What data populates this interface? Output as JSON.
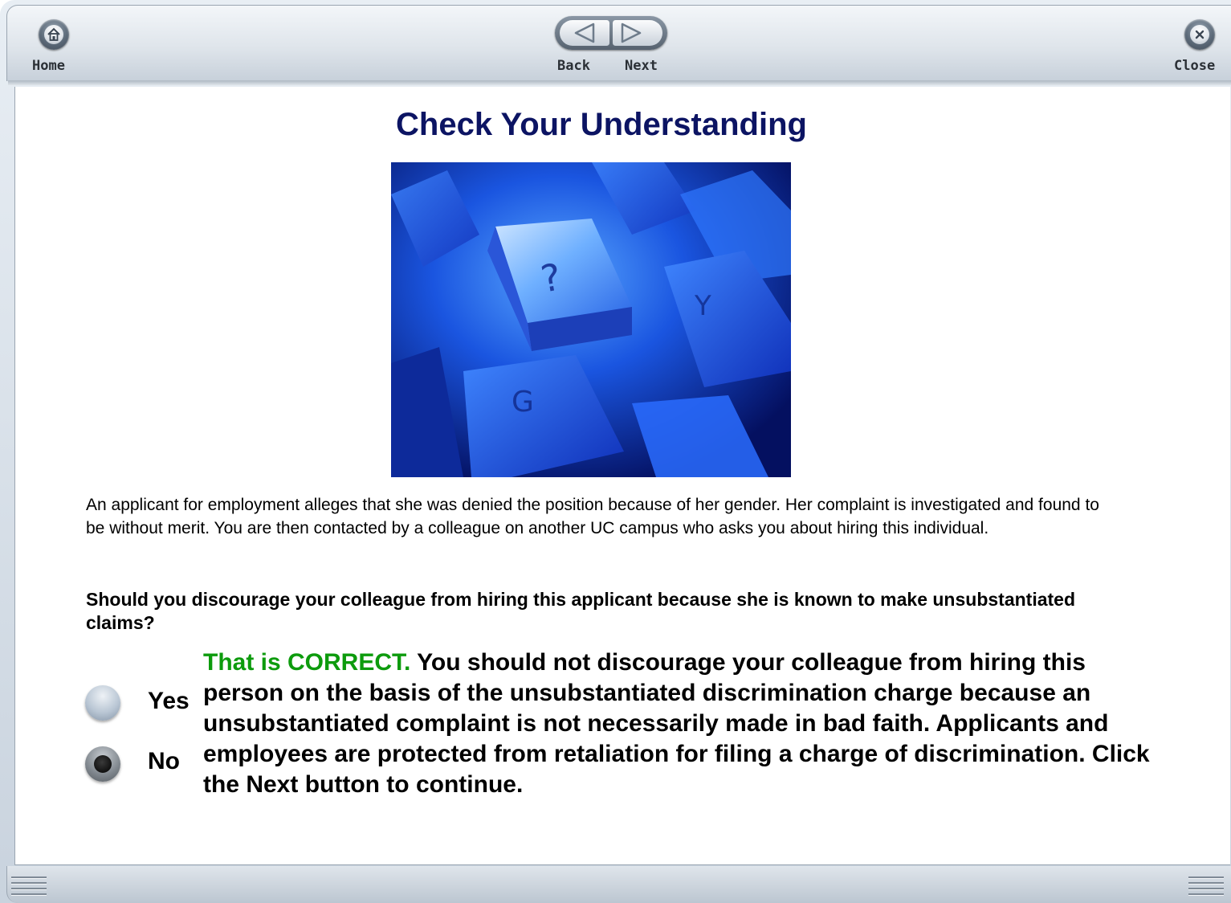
{
  "toolbar": {
    "home_label": "Home",
    "back_label": "Back",
    "next_label": "Next",
    "close_label": "Close"
  },
  "page": {
    "title": "Check Your Understanding",
    "scenario": "An applicant for employment alleges that she was denied the position because of her gender. Her complaint is investigated and found to be without merit. You are then contacted by a colleague on another UC campus who asks you about hiring this individual.",
    "question": "Should you discourage your colleague from hiring this applicant because she is known to make unsubstantiated claims?"
  },
  "answers": [
    {
      "label": "Yes",
      "selected": false
    },
    {
      "label": "No",
      "selected": true
    }
  ],
  "feedback": {
    "verdict": "That is CORRECT.",
    "text": " You should not discourage your colleague from hiring this person on the basis of the unsubstantiated discrimination charge because an unsubstantiated complaint is not necessarily made in bad faith. Applicants and employees are protected from retaliation for filing a charge of discrimination. Click the Next button to continue."
  },
  "colors": {
    "title": "#0c1463",
    "correct": "#0d9b0d"
  },
  "image": {
    "subject": "keyboard-question-key"
  }
}
